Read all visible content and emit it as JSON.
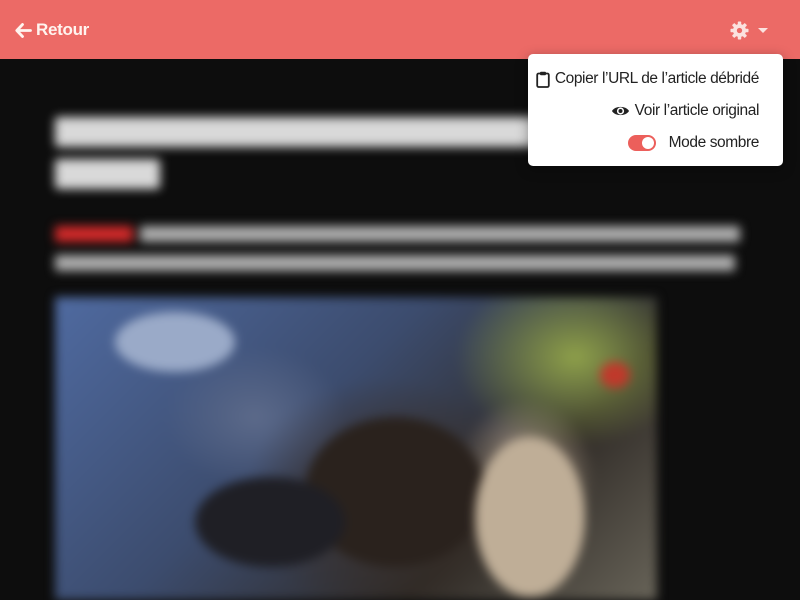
{
  "header": {
    "back_label": "Retour",
    "settings_icon": "gear-icon",
    "accent_color": "#ec6a66"
  },
  "menu": {
    "items": [
      {
        "label": "Copier l’URL de l’article débridé",
        "icon": "clipboard-icon"
      },
      {
        "label": "Voir l’article original",
        "icon": "eye-icon"
      },
      {
        "label": "Mode sombre",
        "icon": "toggle-switch",
        "checked": true
      }
    ]
  }
}
